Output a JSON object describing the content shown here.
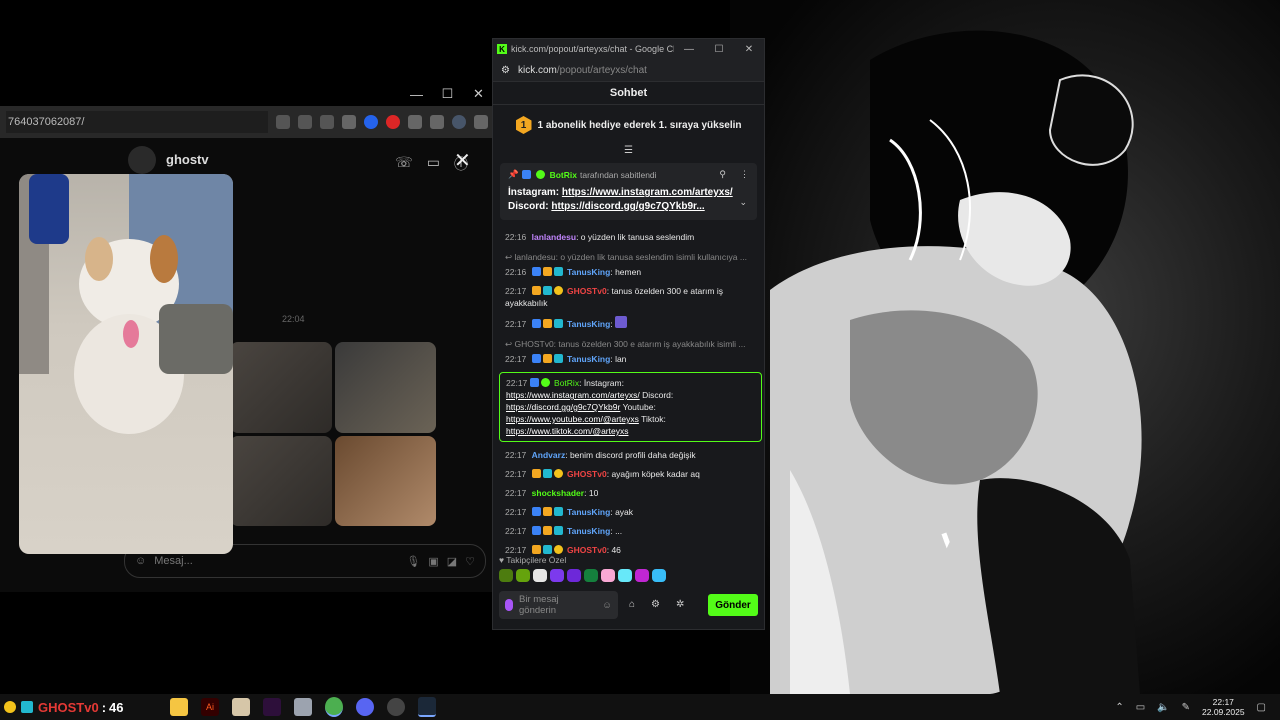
{
  "bg_browser": {
    "url_fragment": "764037062087/",
    "dm_user": "ghostv",
    "time_label": "22:04",
    "composer_placeholder": "Mesaj..."
  },
  "chat_window": {
    "window_title": "kick.com/popout/arteyxs/chat - Google Chr...",
    "url_host": "kick.com",
    "url_path": "/popout/arteyxs/chat",
    "header": "Sohbet",
    "promo_rank": "1",
    "promo_text": "1 abonelik hediye ederek 1. sıraya yükselin",
    "pinned": {
      "by_user": "BotRix",
      "by_suffix": "tarafından sabitlendi",
      "line1_label": "İnstagram:",
      "line1_link": "https://www.instagram.com/arteyxs/",
      "line2_label": "Discord:",
      "line2_link": "https://discord.gg/g9c7QYkb9r..."
    },
    "messages": [
      {
        "time": "22:16",
        "user": "lanlandesu",
        "color": "#c084fc",
        "text": "o yüzden lik tanusa seslendim"
      },
      {
        "reply": "lanlandesu: o yüzden lik tanusa seslendim isimli kullanıcıya ..."
      },
      {
        "time": "22:16",
        "user": "TanusKing",
        "color": "#60a5fa",
        "text": "hemen"
      },
      {
        "time": "22:17",
        "user": "GHOSTv0",
        "color": "#ef4444",
        "text": "tanus özelden 300 e atarım iş ayakkabılık"
      },
      {
        "time": "22:17",
        "user": "TanusKing",
        "color": "#60a5fa",
        "text": ""
      },
      {
        "reply": "GHOSTv0: tanus özelden 300 e atarım iş ayakkabılık isimli ..."
      },
      {
        "time": "22:17",
        "user": "TanusKing",
        "color": "#60a5fa",
        "text": "lan"
      }
    ],
    "bot_message": {
      "time": "22:17",
      "user": "BotRix",
      "text_a": "İnstagram:",
      "link_a": "https://www.instagram.com/arteyxs/",
      "text_b": "Discord:",
      "link_b": "https://discord.gg/g9c7QYkb9r",
      "text_c": "Youtube:",
      "link_c": "https://www.youtube.com/@arteyxs",
      "text_d": "Tiktok:",
      "link_d": "https://www.tiktok.com/@arteyxs"
    },
    "messages2": [
      {
        "time": "22:17",
        "user": "Andvarz",
        "color": "#60a5fa",
        "text": "benim discord profili daha değişik"
      },
      {
        "time": "22:17",
        "user": "GHOSTv0",
        "color": "#ef4444",
        "text": "ayağım köpek kadar aq"
      },
      {
        "time": "22:17",
        "user": "shockshader",
        "color": "#53fc18",
        "text": "10"
      },
      {
        "time": "22:17",
        "user": "TanusKing",
        "color": "#60a5fa",
        "text": "ayak"
      },
      {
        "time": "22:17",
        "user": "TanusKing",
        "color": "#60a5fa",
        "text": "..."
      },
      {
        "time": "22:17",
        "user": "GHOSTv0",
        "color": "#ef4444",
        "text": "46"
      }
    ],
    "followers_label": "Takipçilere Özel",
    "composer_placeholder": "Bir mesaj gönderin",
    "send_label": "Gönder"
  },
  "taskbar": {
    "overlay_name": "GHOSTv0",
    "overlay_value": "46",
    "time": "22:17",
    "date": "22.09.2025"
  }
}
